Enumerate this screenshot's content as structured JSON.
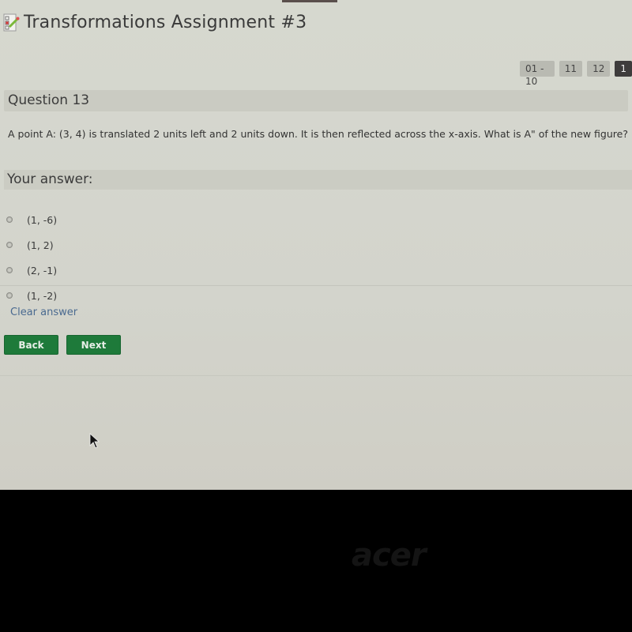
{
  "app": {
    "title": "Transformations Assignment #3",
    "title_icon": "quiz-checklist-icon"
  },
  "pager": {
    "items": [
      {
        "label": "01 - 10",
        "active": false
      },
      {
        "label": "11",
        "active": false
      },
      {
        "label": "12",
        "active": false
      },
      {
        "label": "1",
        "active": true
      }
    ]
  },
  "question": {
    "header": "Question 13",
    "text": "A point A: (3, 4) is translated 2 units left and 2 units down. It is then reflected across the x-axis. What is A\" of the new figure?"
  },
  "answer": {
    "header": "Your answer:",
    "options": [
      {
        "label": "(1, -6)",
        "selected": false
      },
      {
        "label": "(1, 2)",
        "selected": false
      },
      {
        "label": "(2, -1)",
        "selected": false
      },
      {
        "label": "(1, -2)",
        "selected": false
      }
    ],
    "clear_label": "Clear answer"
  },
  "navigation": {
    "back_label": "Back",
    "next_label": "Next"
  },
  "colors": {
    "button_green": "#1e7a3a",
    "link_blue": "#4a6a90",
    "active_page": "#3e3c3c"
  },
  "bezel": {
    "logo_text": "acer"
  }
}
